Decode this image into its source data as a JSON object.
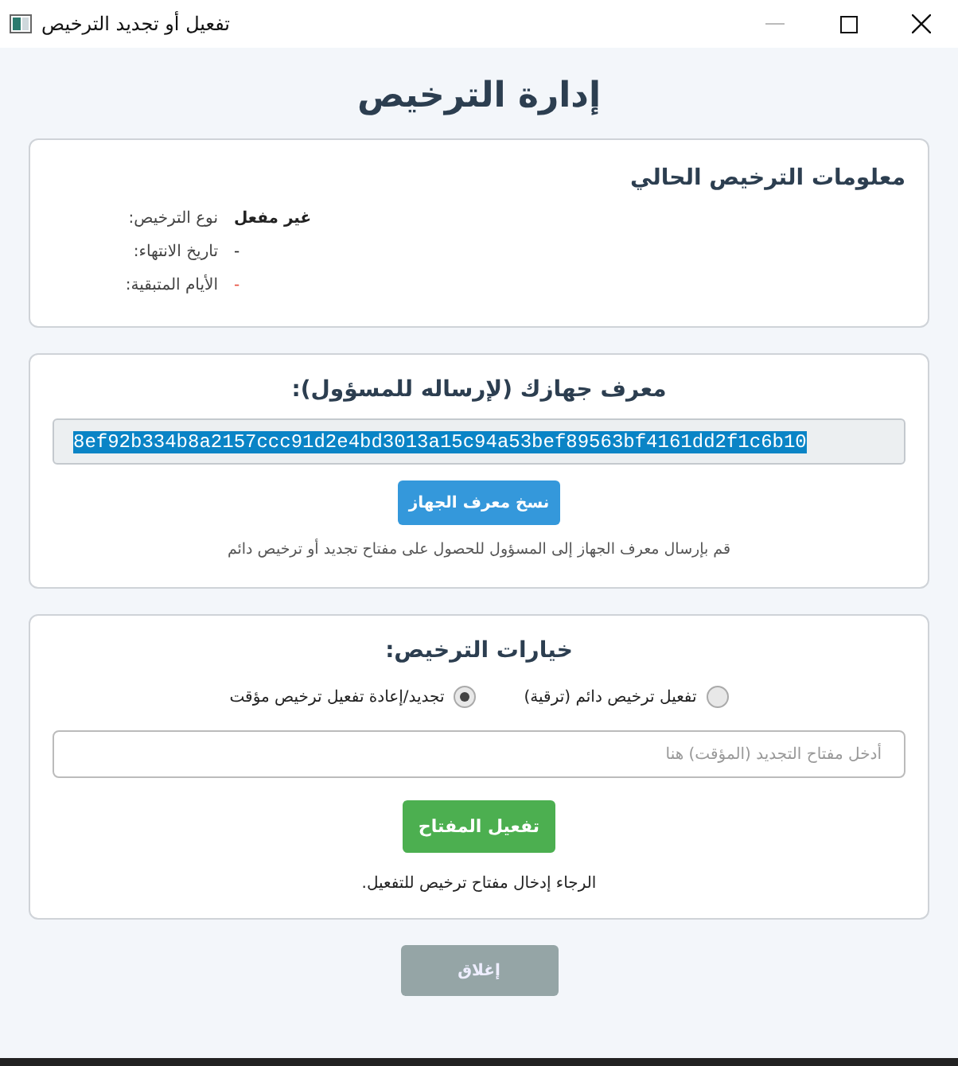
{
  "window": {
    "title": "تفعيل أو تجديد الترخيص"
  },
  "heading": "إدارة الترخيص",
  "license_info": {
    "title": "معلومات الترخيص الحالي",
    "rows": [
      {
        "label": "نوع الترخيص:",
        "value": "غير مفعل",
        "bold": true,
        "color": "#222222"
      },
      {
        "label": "تاريخ الانتهاء:",
        "value": "-",
        "bold": false,
        "color": "#222222"
      },
      {
        "label": "الأيام المتبقية:",
        "value": "-",
        "bold": false,
        "color": "#e74c3c"
      }
    ]
  },
  "device": {
    "title": "معرف جهازك (لإرساله للمسؤول):",
    "device_id": "8ef92b334b8a2157ccc91d2e4bd3013a15c94a53bef89563bf4161dd2f1c6b10",
    "id_selected": true,
    "copy_button": "نسخ معرف الجهاز",
    "hint": "قم بإرسال معرف الجهاز إلى المسؤول للحصول على مفتاح تجديد أو ترخيص دائم"
  },
  "options": {
    "title": "خيارات الترخيص:",
    "radios": [
      {
        "label": "تفعيل ترخيص دائم (ترقية)",
        "selected": false
      },
      {
        "label": "تجديد/إعادة تفعيل ترخيص مؤقت",
        "selected": true
      }
    ],
    "key_field": {
      "placeholder": "أدخل مفتاح التجديد (المؤقت) هنا"
    },
    "activate_button": "تفعيل المفتاح",
    "status": "الرجاء إدخال مفتاح ترخيص للتفعيل."
  },
  "close_button": {
    "label": "إغلاق",
    "disabled": true
  }
}
